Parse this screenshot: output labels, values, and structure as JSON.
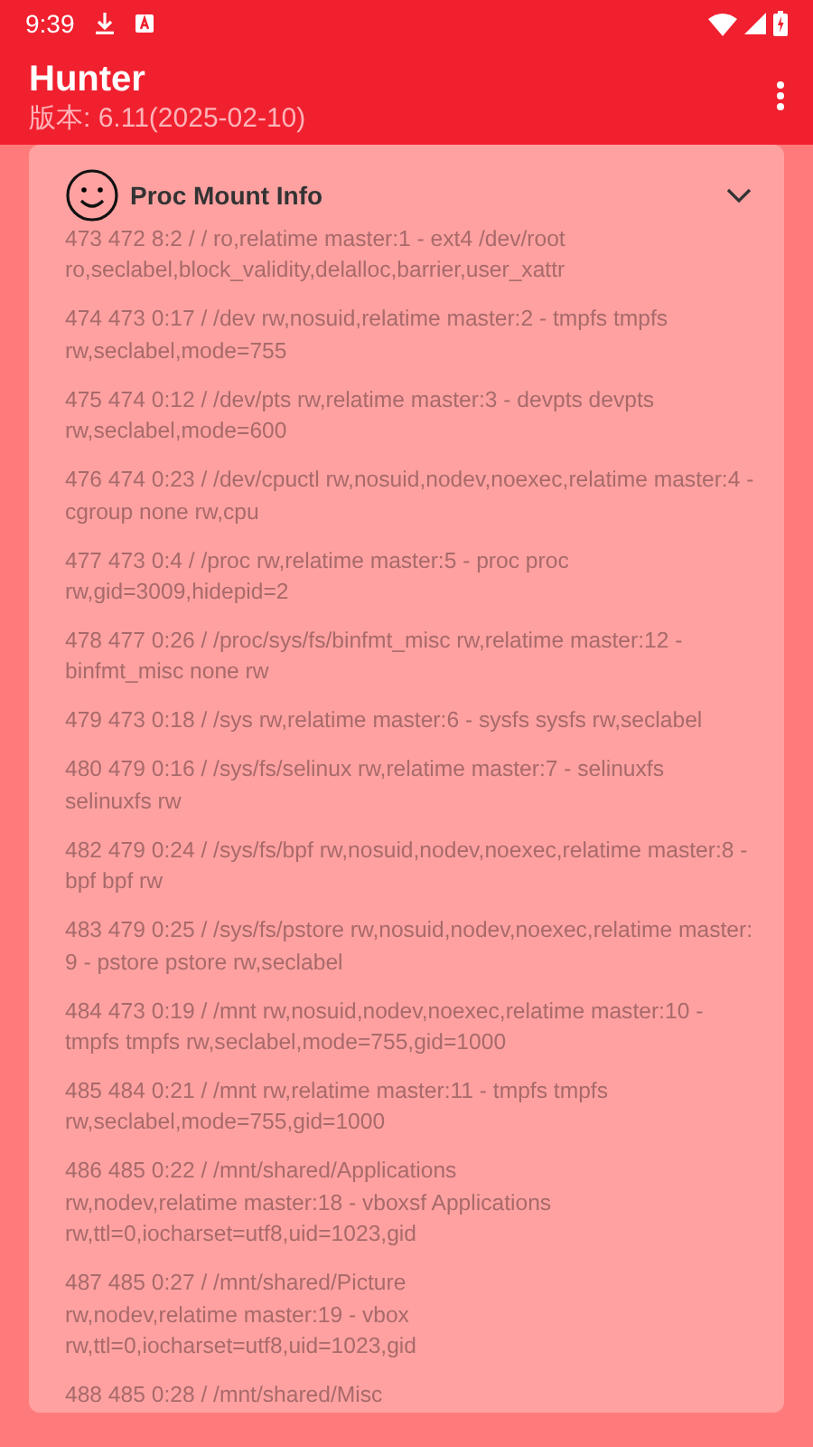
{
  "status_bar": {
    "time": "9:39"
  },
  "app_bar": {
    "title": "Hunter",
    "subtitle": "版本: 6.11(2025-02-10)"
  },
  "card": {
    "title": "Proc Mount Info",
    "expanded": true,
    "entries": [
      {
        "lines": [
          "473 472 8:2 / / ro,relatime master:1 - ext4 /dev/root",
          "ro,seclabel,block_validity,delalloc,barrier,user_xattr"
        ]
      },
      {
        "lines": [
          "474 473 0:17 / /dev rw,nosuid,relatime master:2 - tmpfs tmpfs",
          "rw,seclabel,mode=755"
        ]
      },
      {
        "lines": [
          "475 474 0:12 / /dev/pts rw,relatime master:3 - devpts devpts",
          "rw,seclabel,mode=600"
        ]
      },
      {
        "lines": [
          "476 474 0:23 / /dev/cpuctl rw,nosuid,nodev,noexec,relatime master:4 -",
          "cgroup none rw,cpu"
        ]
      },
      {
        "lines": [
          "477 473 0:4 / /proc rw,relatime master:5 - proc proc",
          "rw,gid=3009,hidepid=2"
        ]
      },
      {
        "lines": [
          "478 477 0:26 / /proc/sys/fs/binfmt_misc rw,relatime master:12 -",
          "binfmt_misc none rw"
        ]
      },
      {
        "lines": [
          "479 473 0:18 / /sys rw,relatime master:6 - sysfs sysfs rw,seclabel"
        ]
      },
      {
        "lines": [
          "480 479 0:16 / /sys/fs/selinux rw,relatime master:7 - selinuxfs",
          "selinuxfs rw"
        ]
      },
      {
        "lines": [
          "482 479 0:24 / /sys/fs/bpf rw,nosuid,nodev,noexec,relatime master:8 -",
          "bpf bpf rw"
        ]
      },
      {
        "lines": [
          "483 479 0:25 / /sys/fs/pstore rw,nosuid,nodev,noexec,relatime master:",
          "9 - pstore pstore rw,seclabel"
        ]
      },
      {
        "lines": [
          "484 473 0:19 / /mnt rw,nosuid,nodev,noexec,relatime master:10 -",
          "tmpfs tmpfs rw,seclabel,mode=755,gid=1000"
        ]
      },
      {
        "lines": [
          "485 484 0:21 / /mnt rw,relatime master:11 - tmpfs tmpfs",
          "rw,seclabel,mode=755,gid=1000"
        ]
      },
      {
        "lines": [
          "486 485 0:22 / /mnt/shared/Applications",
          "rw,nodev,relatime master:18 - vboxsf Applications",
          "rw,ttl=0,iocharset=utf8,uid=1023,gid"
        ]
      },
      {
        "lines": [
          "487 485 0:27 / /mnt/shared/Picture",
          "rw,nodev,relatime master:19 - vbox",
          "rw,ttl=0,iocharset=utf8,uid=1023,gid"
        ]
      },
      {
        "lines": [
          "488 485 0:28 / /mnt/shared/Misc"
        ]
      }
    ]
  }
}
